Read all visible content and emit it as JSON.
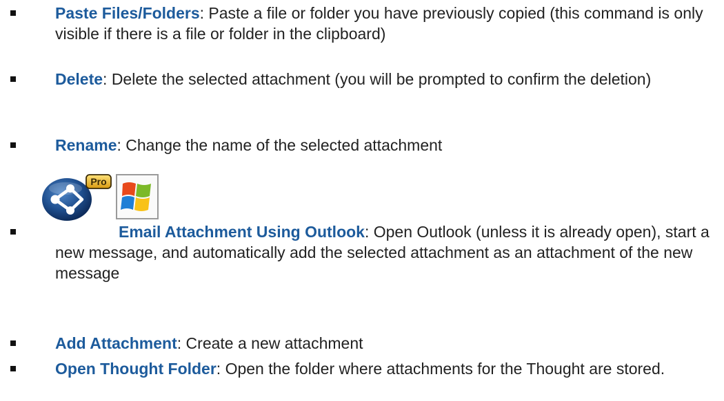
{
  "colors": {
    "term": "#1d5b9c",
    "text": "#222222",
    "bullet": "#111111"
  },
  "items": [
    {
      "term": "Paste Files/Folders",
      "description": ": Paste a file or folder you have previously copied (this command is only visible if there is a file or folder in the clipboard)"
    },
    {
      "term": "Delete",
      "description": ": Delete the selected attachment (you will be prompted to confirm the deletion)"
    },
    {
      "term": "Rename",
      "description": ": Change the name of the selected attachment"
    },
    {
      "term": "Email Attachment Using Outlook",
      "description": ": Open Outlook (unless it is already open), start a new message, and automatically add the selected attachment as an attachment of the new message",
      "badge_text": "Pro",
      "icons": [
        "thebrain-pro-logo-icon",
        "windows-logo-icon"
      ]
    },
    {
      "term": "Add Attachment",
      "description": ": Create a new attachment"
    },
    {
      "term": "Open Thought Folder",
      "description": ": Open the folder where attachments for the Thought are stored."
    }
  ]
}
